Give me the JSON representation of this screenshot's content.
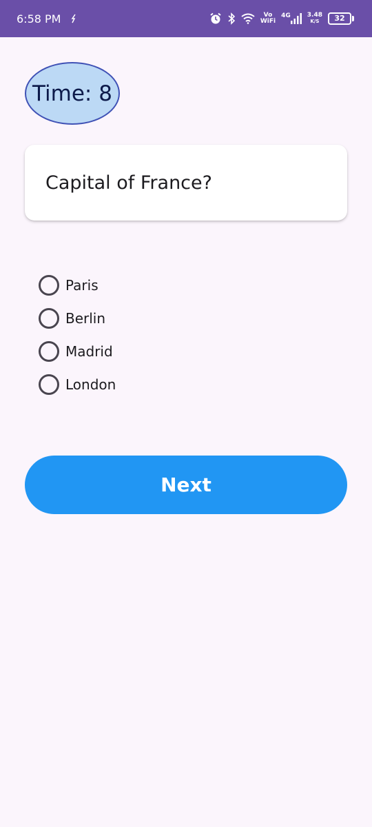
{
  "status_bar": {
    "time": "6:58 PM",
    "network_top": "Vo",
    "network_bottom": "WiFi",
    "cellular": "4G",
    "speed_value": "3.48",
    "speed_unit": "K/S",
    "battery": "32",
    "icons": [
      "alarm-icon",
      "bluetooth-icon",
      "wifi-icon",
      "signal-icon"
    ]
  },
  "timer": {
    "label": "Time: 8"
  },
  "question": {
    "text": "Capital of France?"
  },
  "options": [
    {
      "label": "Paris"
    },
    {
      "label": "Berlin"
    },
    {
      "label": "Madrid"
    },
    {
      "label": "London"
    }
  ],
  "next_button": {
    "label": "Next"
  },
  "colors": {
    "status_bar": "#6a4fa8",
    "background": "#fbf5fc",
    "timer_fill": "#bcd9f5",
    "timer_border": "#3f51b5",
    "button": "#2196f3"
  }
}
